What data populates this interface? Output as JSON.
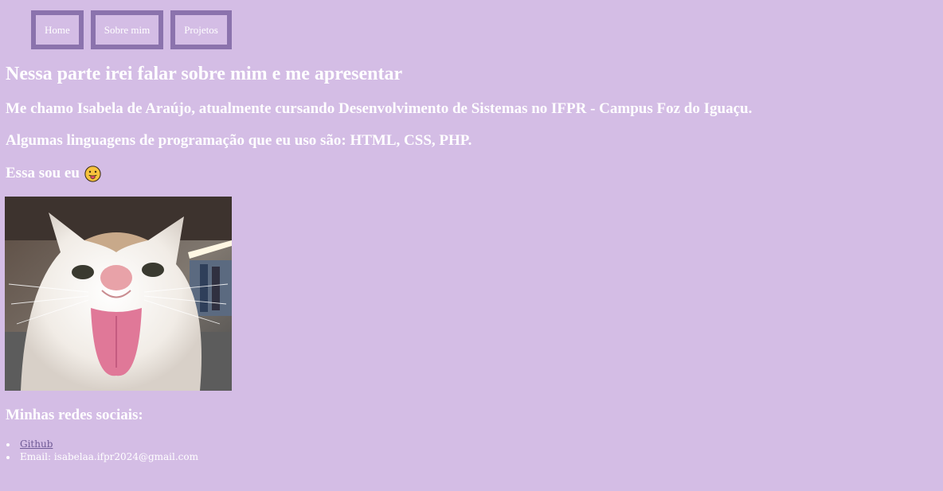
{
  "nav": {
    "items": [
      {
        "label": "Home"
      },
      {
        "label": "Sobre mim"
      },
      {
        "label": "Projetos"
      }
    ]
  },
  "content": {
    "title": "Nessa parte irei falar sobre mim e me apresentar",
    "intro": "Me chamo Isabela de Araújo, atualmente cursando Desenvolvimento de Sistemas no IFPR - Campus Foz do Iguaçu.",
    "languages": "Algumas linguagens de programação que eu uso são: HTML, CSS, PHP.",
    "me_label": "Essa sou eu",
    "me_emoji": "tongue-out-face-icon",
    "photo": "cat-tongue-out-photo"
  },
  "social": {
    "title": "Minhas redes sociais:",
    "github_label": "Github",
    "email_text": "Email: isabelaa.ifpr2024@gmail.com"
  },
  "colors": {
    "background": "#d4bde5",
    "nav_border": "#8b73ad",
    "text": "#ffffff",
    "link": "#6f5a96"
  }
}
